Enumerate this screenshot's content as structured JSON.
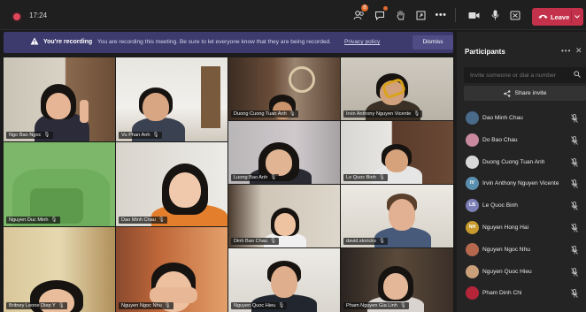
{
  "topbar": {
    "timer": "17:24",
    "participants_badge": "8",
    "leave_label": "Leave",
    "icons": [
      "people-icon",
      "chat-icon",
      "raise-hand-icon",
      "share-tray-icon",
      "more-icon",
      "camera-icon",
      "mic-icon",
      "share-screen-icon",
      "phone-hangup-icon",
      "chevron-down-icon"
    ]
  },
  "banner": {
    "title": "You're recording",
    "message": "You are recording this meeting. Be sure to let everyone know that they are being recorded.",
    "link": "Privacy policy",
    "dismiss_label": "Dismiss"
  },
  "tiles": [
    {
      "name": "Ngo Bao Ngoc"
    },
    {
      "name": "Vu Phan Anh"
    },
    {
      "name": "Duong Cuong Tuan Anh"
    },
    {
      "name": "Irvin Anthony Nguyen Vicente"
    },
    {
      "name": "Nguyen Duc Minh"
    },
    {
      "name": "Dao Minh Chau"
    },
    {
      "name": "Luong Bao Anh"
    },
    {
      "name": "Le Quoc Binh"
    },
    {
      "name": "Dinh Bao Chau"
    },
    {
      "name": "david.storicks"
    },
    {
      "name": "Britney Leone Diep Y"
    },
    {
      "name": "Nguyen Ngoc Nhu"
    },
    {
      "name": "Nguyen Quoc Hieu"
    },
    {
      "name": "Pham Nguyen Gia Linh"
    }
  ],
  "panel": {
    "title": "Participants",
    "invite_placeholder": "Invite someone or dial a number",
    "share_label": "Share invite",
    "participants": [
      {
        "name": "Dao Minh Chau",
        "initials": "",
        "color": "#4a6a8a"
      },
      {
        "name": "Do Bao Chau",
        "initials": "",
        "color": "#c98aa0"
      },
      {
        "name": "Duong Cuong Tuan Anh",
        "initials": "",
        "color": "#d8d8d8"
      },
      {
        "name": "Irvin Anthony Nguyen Vicente",
        "initials": "IV",
        "color": "#5b8fb0"
      },
      {
        "name": "Le Quoc Binh",
        "initials": "LB",
        "color": "#7b7fb5"
      },
      {
        "name": "Nguyen Hong Hai",
        "initials": "NH",
        "color": "#c79a2e"
      },
      {
        "name": "Nguyen Ngoc Nhu",
        "initials": "",
        "color": "#b5684e"
      },
      {
        "name": "Nguyen Quoc Hieu",
        "initials": "",
        "color": "#c9a07a"
      },
      {
        "name": "Pham Dinh Chi",
        "initials": "",
        "color": "#b5253a"
      }
    ]
  }
}
